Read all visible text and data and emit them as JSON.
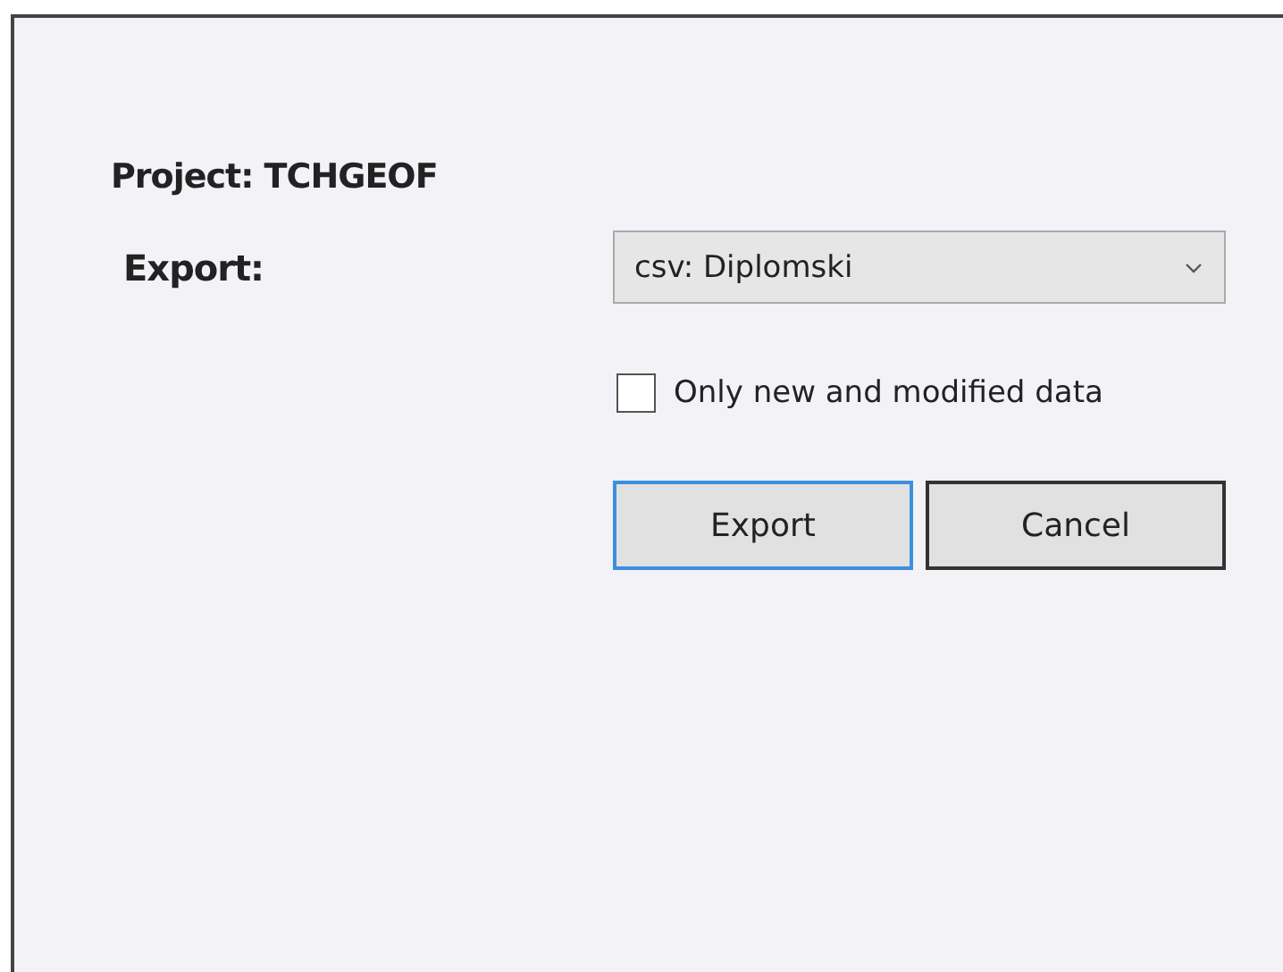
{
  "project_label": "Project: TCHGEOF",
  "export_label": "Export:",
  "export_select": {
    "value": "csv: Diplomski"
  },
  "only_new_checkbox": {
    "label": "Only new and modified data",
    "checked": false
  },
  "buttons": [
    {
      "label": "Export",
      "focused": true
    },
    {
      "label": "Cancel",
      "focused": false
    }
  ]
}
